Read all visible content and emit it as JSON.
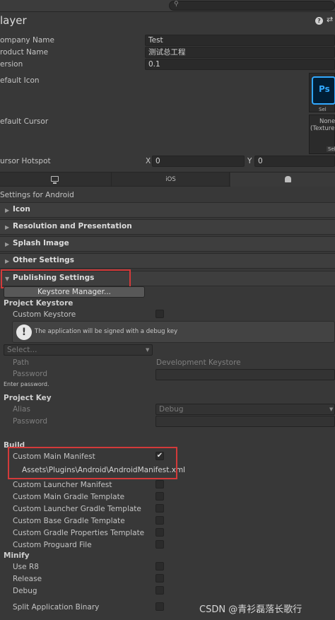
{
  "search": {
    "placeholder": ""
  },
  "header": {
    "title": "layer"
  },
  "fields": {
    "company_label": "ompany Name",
    "company_value": "Test",
    "product_label": "roduct Name",
    "product_value": "测试总工程",
    "version_label": "ersion",
    "version_value": "0.1",
    "icon_label": "efault Icon",
    "icon_select": "Sel",
    "cursor_label": "efault Cursor",
    "cursor_none": "None",
    "cursor_type": "(Texture",
    "cursor_select": "Sel",
    "hotspot_label": "ursor Hotspot",
    "x_label": "X",
    "x_value": "0",
    "y_label": "Y",
    "y_value": "0"
  },
  "platform_tabs": [
    {
      "label": "",
      "icon": "monitor-icon"
    },
    {
      "label": "iOS"
    },
    {
      "label": "",
      "icon": "android-icon"
    }
  ],
  "settings_for": "Settings for Android",
  "foldouts": [
    "Icon",
    "Resolution and Presentation",
    "Splash Image",
    "Other Settings",
    "Publishing Settings"
  ],
  "publishing": {
    "keystore_button": "Keystore Manager...",
    "project_keystore": "Project Keystore",
    "custom_keystore": "Custom Keystore",
    "info_message": "The application will be signed with a debug key",
    "select_placeholder": "Select...",
    "path_label": "Path",
    "path_value": "Development Keystore",
    "password_label": "Password",
    "enter_password": "Enter password.",
    "project_key": "Project Key",
    "alias_label": "Alias",
    "alias_value": "Debug",
    "key_password_label": "Password"
  },
  "build": {
    "title": "Build",
    "custom_main_manifest": "Custom Main Manifest",
    "manifest_path": "Assets\\Plugins\\Android\\AndroidManifest.xml",
    "items": [
      "Custom Launcher Manifest",
      "Custom Main Gradle Template",
      "Custom Launcher Gradle Template",
      "Custom Base Gradle Template",
      "Custom Gradle Properties Template",
      "Custom Proguard File"
    ]
  },
  "minify": {
    "title": "Minify",
    "items": [
      "Use R8",
      "Release",
      "Debug"
    ]
  },
  "split": "Split Application Binary",
  "watermark": "CSDN @青衫磊落长歌行",
  "colors": {
    "bg": "#383838",
    "highlight": "#d33a3a",
    "ps_blue": "#31a8ff"
  }
}
